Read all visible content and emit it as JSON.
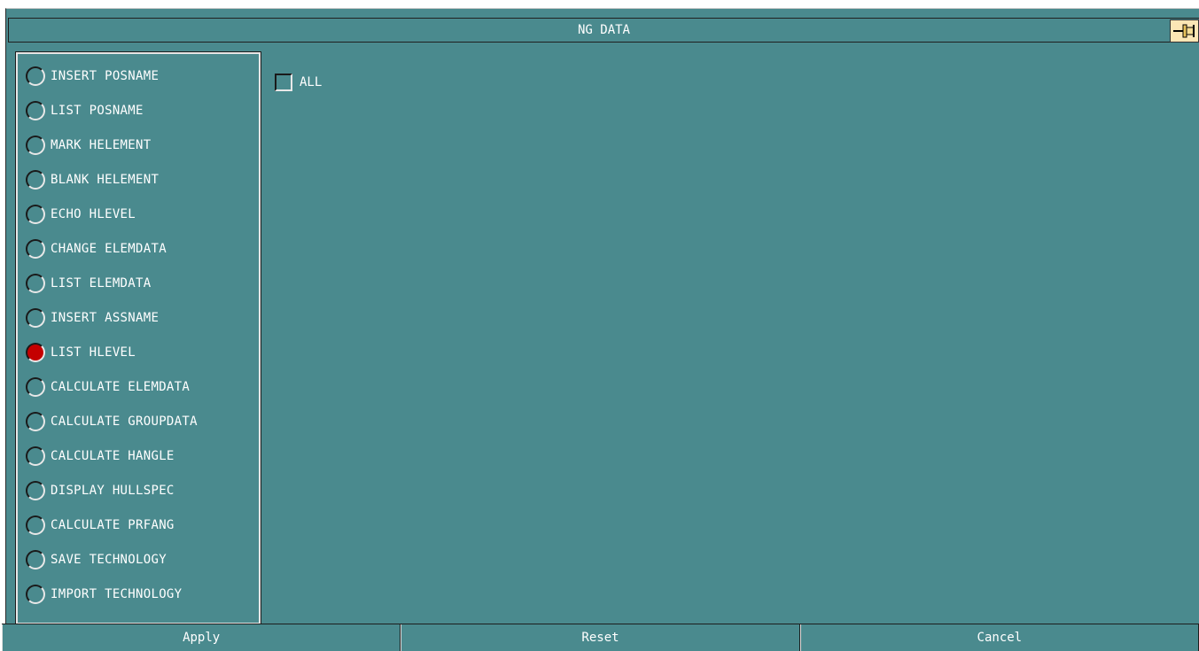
{
  "window": {
    "title": "NG DATA"
  },
  "options": [
    {
      "label": "INSERT POSNAME",
      "selected": false
    },
    {
      "label": "LIST POSNAME",
      "selected": false
    },
    {
      "label": "MARK HELEMENT",
      "selected": false
    },
    {
      "label": "BLANK HELEMENT",
      "selected": false
    },
    {
      "label": "ECHO HLEVEL",
      "selected": false
    },
    {
      "label": "CHANGE ELEMDATA",
      "selected": false
    },
    {
      "label": "LIST ELEMDATA",
      "selected": false
    },
    {
      "label": "INSERT ASSNAME",
      "selected": false
    },
    {
      "label": "LIST HLEVEL",
      "selected": true
    },
    {
      "label": "CALCULATE ELEMDATA",
      "selected": false
    },
    {
      "label": "CALCULATE GROUPDATA",
      "selected": false
    },
    {
      "label": "CALCULATE HANGLE",
      "selected": false
    },
    {
      "label": "DISPLAY HULLSPEC",
      "selected": false
    },
    {
      "label": "CALCULATE PRFANG",
      "selected": false
    },
    {
      "label": "SAVE TECHNOLOGY",
      "selected": false
    },
    {
      "label": "IMPORT TECHNOLOGY",
      "selected": false
    }
  ],
  "all_checkbox": {
    "label": "ALL",
    "checked": false
  },
  "buttons": {
    "apply": "Apply",
    "reset": "Reset",
    "cancel": "Cancel"
  },
  "icons": {
    "pin": "pin-icon"
  },
  "colors": {
    "background": "#4a8a8e",
    "selected_radio": "#c40000",
    "pin_button": "#fbe6b5"
  }
}
